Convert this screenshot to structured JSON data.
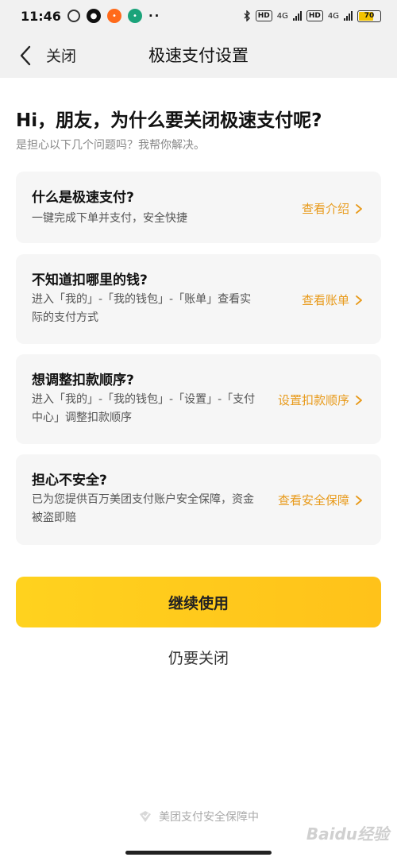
{
  "status_bar": {
    "time": "11:46",
    "network_1": "HD",
    "network_1_gen": "4G",
    "network_2": "HD",
    "network_2_gen": "4G",
    "battery": "70",
    "battery_level": 0.7
  },
  "nav": {
    "close_label": "关闭",
    "title": "极速支付设置"
  },
  "headline": "Hi，朋友，为什么要关闭极速支付呢?",
  "subhead": "是担心以下几个问题吗？我帮你解决。",
  "cards": [
    {
      "title": "什么是极速支付?",
      "desc": "一键完成下单并支付，安全快捷",
      "action": "查看介绍"
    },
    {
      "title": "不知道扣哪里的钱?",
      "desc": "进入「我的」-「我的钱包」-「账单」查看实际的支付方式",
      "action": "查看账单"
    },
    {
      "title": "想调整扣款顺序?",
      "desc": "进入「我的」-「我的钱包」-「设置」-「支付中心」调整扣款顺序",
      "action": "设置扣款顺序"
    },
    {
      "title": "担心不安全?",
      "desc": "已为您提供百万美团支付账户安全保障，资金被盗即赔",
      "action": "查看安全保障"
    }
  ],
  "continue_label": "继续使用",
  "still_close_label": "仍要关闭",
  "footer_note": "美团支付安全保障中",
  "watermark": "Baidu经验",
  "colors": {
    "accent": "#e89a1a",
    "button_yellow": "#ffc21a",
    "card_bg": "#f6f6f6",
    "nav_bg": "#f1f1f1"
  }
}
